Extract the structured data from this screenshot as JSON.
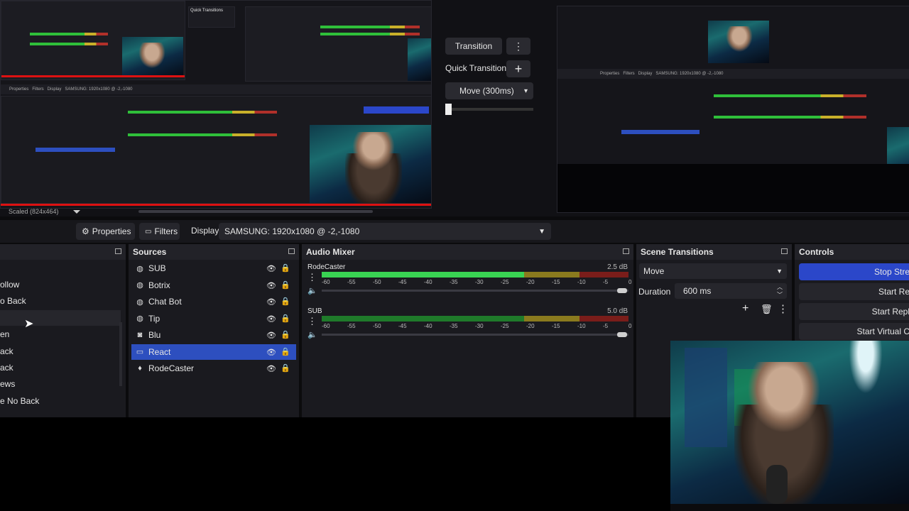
{
  "transition_panel": {
    "transition_label": "Transition",
    "quick_transitions_label": "Quick Transitions",
    "move_select": "Move (300ms)"
  },
  "status": {
    "scaled_label": "Scaled (824x464)"
  },
  "toolbar": {
    "properties_label": "Properties",
    "filters_label": "Filters",
    "display_label": "Display",
    "display_value": "SAMSUNG: 1920x1080 @ -2,-1080"
  },
  "scenes": {
    "items": [
      "ollow",
      "o Back",
      "",
      "en",
      "ack",
      "ack",
      "ews",
      "e No Back"
    ]
  },
  "sources": {
    "title": "Sources",
    "items": [
      {
        "name": "SUB",
        "icon": "globe-icon"
      },
      {
        "name": "Botrix",
        "icon": "globe-icon"
      },
      {
        "name": "Chat Bot",
        "icon": "globe-icon"
      },
      {
        "name": "Tip",
        "icon": "globe-icon"
      },
      {
        "name": "Blu",
        "icon": "camera-icon"
      },
      {
        "name": "React",
        "icon": "monitor-icon",
        "selected": true
      },
      {
        "name": "RodeCaster",
        "icon": "microphone-icon"
      }
    ]
  },
  "audio_mixer": {
    "title": "Audio Mixer",
    "channels": [
      {
        "name": "RodeCaster",
        "db": "2.5 dB",
        "level": 0.66
      },
      {
        "name": "SUB",
        "db": "5.0 dB",
        "level": 0.0
      }
    ],
    "ticks": [
      "-60",
      "-55",
      "-50",
      "-45",
      "-40",
      "-35",
      "-30",
      "-25",
      "-20",
      "-15",
      "-10",
      "-5",
      "0"
    ]
  },
  "scene_transitions": {
    "title": "Scene Transitions",
    "selected": "Move",
    "duration_label": "Duration",
    "duration_value": "600 ms"
  },
  "controls": {
    "title": "Controls",
    "buttons": [
      "Stop Stre",
      "Start Re",
      "Start Repl",
      "Start Virtual C"
    ]
  },
  "colors": {
    "accent": "#2b47c9",
    "meter_green": "#39d353",
    "meter_yellow": "#c9b02a",
    "meter_red": "#b0302a"
  }
}
